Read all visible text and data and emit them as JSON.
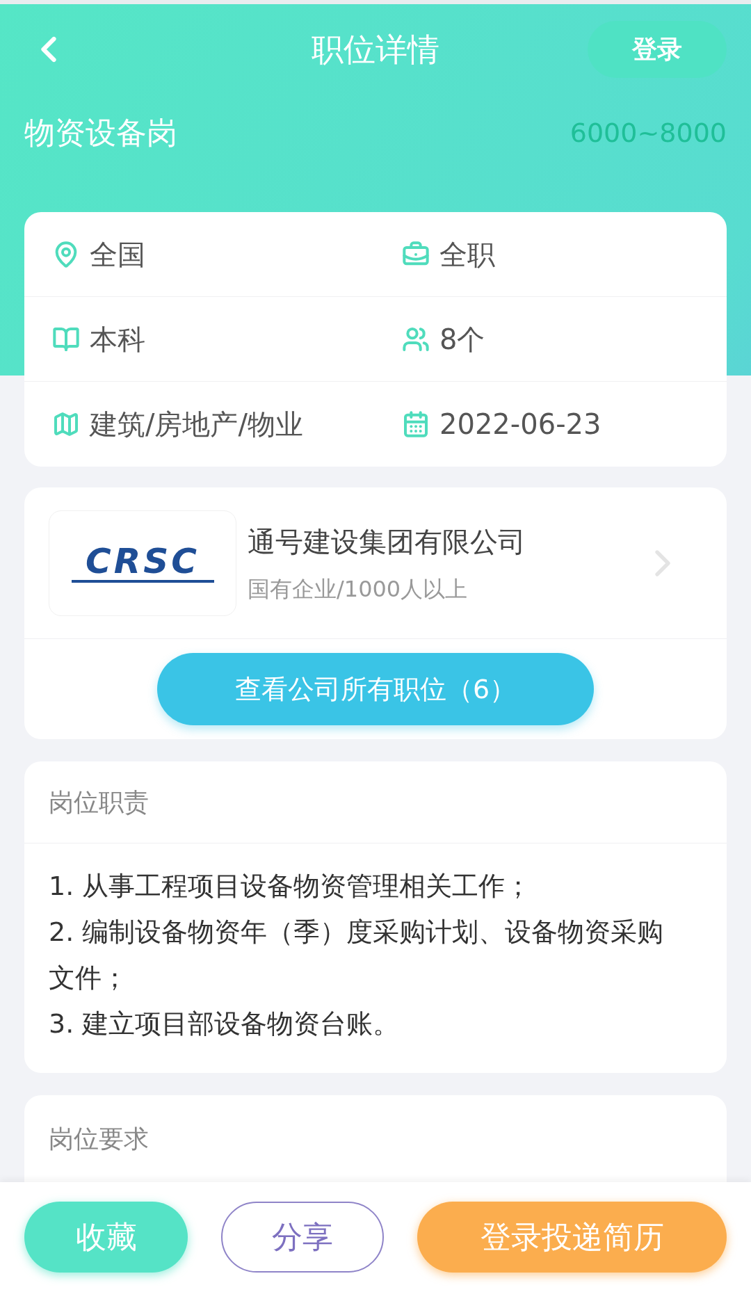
{
  "nav": {
    "title": "职位详情",
    "login": "登录"
  },
  "job": {
    "title": "物资设备岗",
    "salary": "6000~8000"
  },
  "info": [
    "全国",
    "全职",
    "本科",
    "8个",
    "建筑/房地产/物业",
    "2022-06-23"
  ],
  "company": {
    "logo_text": "CRSC",
    "name": "通号建设集团有限公司",
    "meta": "国有企业/1000人以上",
    "all_jobs": "查看公司所有职位（6）"
  },
  "duties": {
    "heading": "岗位职责",
    "lines": [
      "1. 从事工程项目设备物资管理相关工作；",
      "2. 编制设备物资年（季）度采购计划、设备物资采购文件；",
      "3. 建立项目部设备物资台账。"
    ]
  },
  "requirements": {
    "heading": "岗位要求"
  },
  "actions": [
    "收藏",
    "分享",
    "登录投递简历"
  ]
}
